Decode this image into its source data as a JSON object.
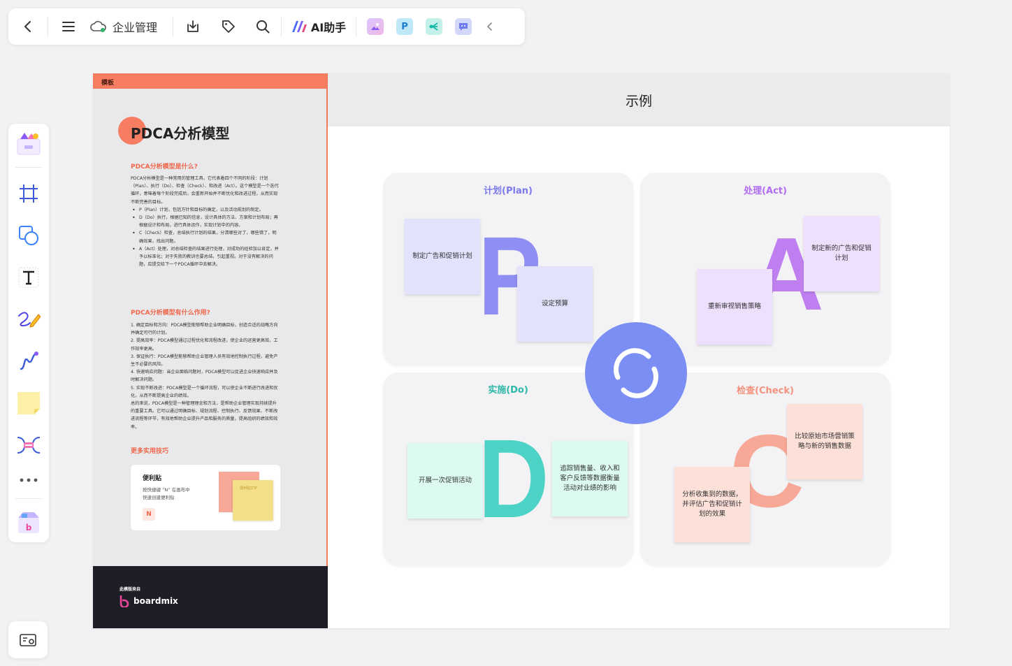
{
  "toolbar": {
    "workspace_label": "企业管理",
    "ai_label": "AI助手"
  },
  "template": {
    "header_label": "模板",
    "title": "PDCA分析模型",
    "section1_title": "PDCA分析模型是什么?",
    "section1_intro": "PDCA分析模型是一种常用的管理工具，它代表着四个不同的阶段：计划（Plan）、执行（Do）、检查（Check）、和改进（Act）。这个模型是一个迭代循环，意味着每个阶段完成后，会重新开始并不断优化和改进过程，从而实现不断完善的目标。",
    "section1_points": [
      "P（Plan）计划，包括方针和目标的确定，以及活动规划的制定。",
      "D（Do）执行，根据已知的信息，设计具体的方法、方案和计划布局；再根据设计和布局，进行具体运作，实现计划中的内容。",
      "C（Check）检查，总结执行计划的结果，分清哪些对了，哪些错了，明确效果，找出问题。",
      "A（Act）处理，对总结检查的结果进行处理，对成功的经验加以肯定，并予以标准化；对于失败的教训也要总结，引起重视。对于没有解决的问题，应提交给下一个PDCA循环中去解决。"
    ],
    "section2_title": "PDCA分析模型有什么作用?",
    "section2_items": [
      "1. 确定目标和方向：PDCA模型能够帮助企业明确目标，创造合适的战略方向并确定可行的计划。",
      "2. 提高效率：PDCA模型通过过程优化和流程改进，使企业的运营更高效，工作效率更高。",
      "3. 保证执行：PDCA模型能够帮助企业管理人员有效地控制执行过程，避免产生不必要的风险。",
      "4. 快速响应问题：当企业面临问题时，PDCA模型可以促进企业快速响应并及时解决问题。",
      "5. 实现不断改进：PDCA模型是一个循环流程，可以使企业不断进行改进和优化，从而不断提高企业的绩效。",
      "总的来说，PDCA模型是一种管理理念和方法，是帮助企业管理实现持续提升的重要工具。它可以通过明确目标、规划流程、控制执行、反馈效果、不断改进流程等环节，有效地帮助企业提升产品和服务的质量，提高组织的绩效和效率。"
    ],
    "section3_title": "更多实用技巧",
    "tip_title": "便利贴",
    "tip_desc_1": "按快捷键 “N” 在画布中",
    "tip_desc_2": "快速创建便利贴",
    "tip_key": "N",
    "tip_note_text": "便利贴文字",
    "footer_from": "此模版来自",
    "footer_brand": "boardmix"
  },
  "example": {
    "header": "示例",
    "plan": {
      "title": "计划(Plan)",
      "letter": "P",
      "notes": [
        "制定广告和促销计划",
        "设定预算"
      ]
    },
    "act": {
      "title": "处理(Act)",
      "letter": "A",
      "notes": [
        "制定新的广告和促销计划",
        "重新审视销售策略"
      ]
    },
    "do": {
      "title": "实施(Do)",
      "letter": "D",
      "notes": [
        "开展一次促销活动",
        "追踪销售量、收入和客户反馈等数据衡量活动对业绩的影响"
      ]
    },
    "check": {
      "title": "检查(Check)",
      "letter": "C",
      "notes": [
        "比较原始市场营销策略与新的销售数据",
        "分析收集到的数据，并评估广告和促销计划的效果"
      ]
    }
  },
  "colors": {
    "template_accent": "#f77d62",
    "plan_color": "#8f8ef2",
    "act_color": "#c07ff0",
    "do_color": "#4dd2c6",
    "check_color": "#f7a897",
    "center_circle": "#7b8ef3"
  },
  "icons": [
    "back-icon",
    "menu-icon",
    "cloud-icon",
    "download-icon",
    "tag-icon",
    "search-icon",
    "ai-logo-icon",
    "image-app-icon",
    "p-app-icon",
    "mindmap-app-icon",
    "chat-app-icon",
    "collapse-icon",
    "template-icon",
    "frame-icon",
    "shape-icon",
    "text-icon",
    "pen-icon",
    "connector-icon",
    "sticky-note-icon",
    "mindmap-icon",
    "more-icon",
    "apps-icon",
    "minimap-icon"
  ]
}
